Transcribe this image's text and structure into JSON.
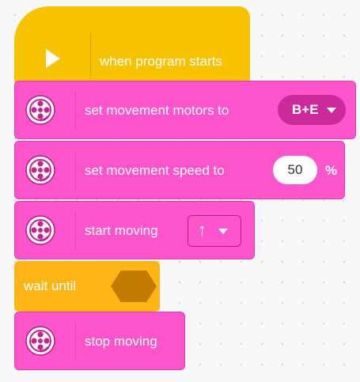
{
  "blocks": {
    "start": {
      "label": "when program starts",
      "icon": "play-icon"
    },
    "set_motors": {
      "label": "set movement motors to",
      "value": "B+E",
      "icon": "motor-icon"
    },
    "set_speed": {
      "label": "set movement speed to",
      "value": "50",
      "unit": "%",
      "icon": "motor-icon"
    },
    "start_moving": {
      "label": "start moving",
      "direction": "↑",
      "icon": "motor-icon"
    },
    "wait_until": {
      "label": "wait until"
    },
    "stop_moving": {
      "label": "stop moving",
      "icon": "motor-icon"
    }
  },
  "colors": {
    "events": "#f7c200",
    "movement": "#ff55cc",
    "control": "#ffb515",
    "dropdown": "#cc2a9a",
    "empty_slot": "#c47c00"
  }
}
